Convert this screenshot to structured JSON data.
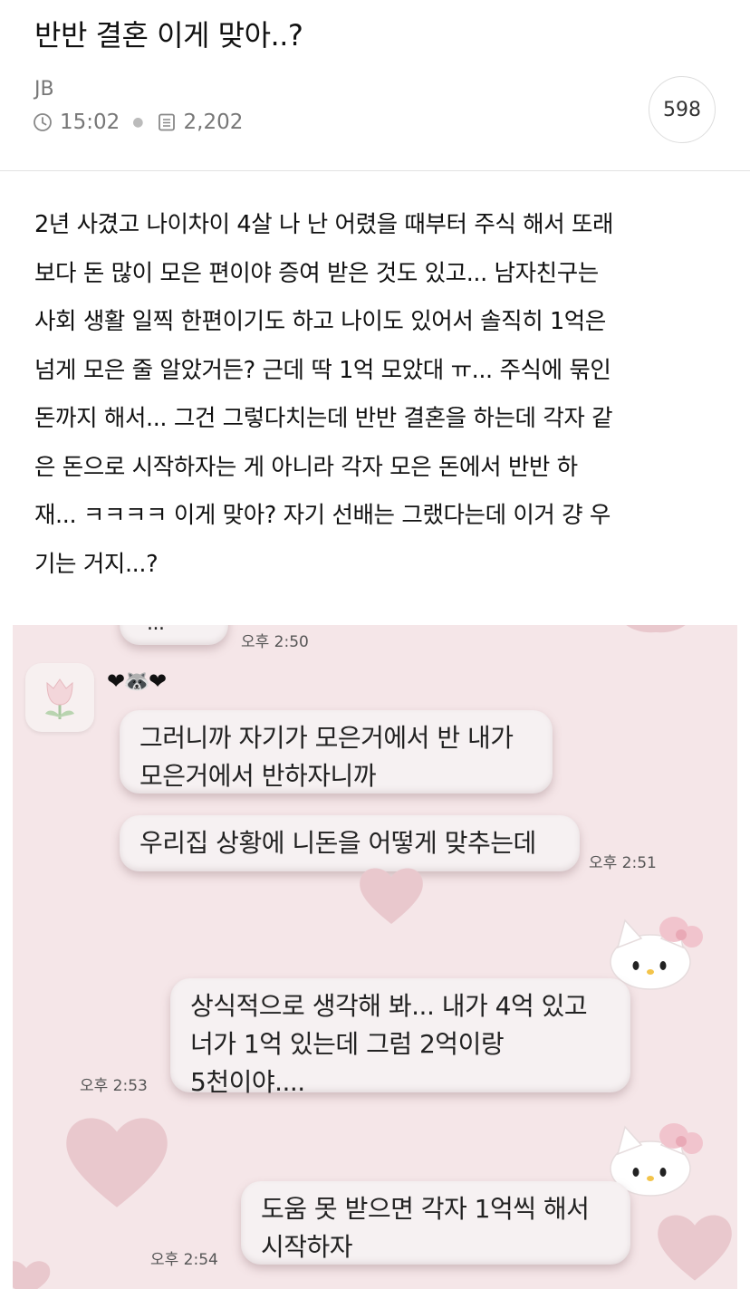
{
  "post": {
    "title": "반반 결혼 이게 맞아..?",
    "author": "JB",
    "time": "15:02",
    "views": "2,202",
    "comment_count": "598"
  },
  "content": {
    "lines": [
      "2년 사겼고 나이차이 4살 나 난 어렸을 때부터 주식 해서 또래",
      "보다 돈 많이 모은 편이야 증여 받은 것도 있고... 남자친구는",
      "사회 생활 일찍 한편이기도 하고 나이도 있어서 솔직히 1억은",
      "넘게 모은 줄 알았거든? 근데 딱 1억 모았대 ㅠ... 주식에 묶인",
      "돈까지 해서... 그건 그렇다치는데 반반 결혼을 하는데 각자 같",
      "은 돈으로 시작하자는 게 아니라 각자 모은 돈에서 반반 하",
      "재... ㅋㅋㅋㅋ 이게 맞아? 자기 선배는 그랬다는데 이거 걍 우",
      "기는 거지...?"
    ]
  },
  "chat": {
    "top_partial": "...",
    "top_time": "오후 2:50",
    "sender_emoji": "❤🦝❤",
    "messages": [
      {
        "side": "left",
        "lines": [
          "그러니까 자기가 모은거에서 반 내가",
          "모은거에서 반하자니까"
        ],
        "time": ""
      },
      {
        "side": "left",
        "lines": [
          "우리집 상황에 니돈을 어떻게 맞추는데"
        ],
        "time": "오후 2:51"
      },
      {
        "side": "right",
        "lines": [
          "상식적으로 생각해 봐... 내가 4억 있고",
          "너가 1억 있는데 그럼 2억이랑",
          "5천이야...."
        ],
        "time": "오후 2:53"
      },
      {
        "side": "right",
        "lines": [
          "도움 못 받으면 각자 1억씩 해서",
          "시작하자"
        ],
        "time": "오후 2:54"
      }
    ]
  },
  "icons": {
    "clock": "clock-icon",
    "views": "document-icon"
  },
  "colors": {
    "chat_background": "#f5e6e8",
    "bubble": "#f6f1f2",
    "heart": "#e9c8cd"
  }
}
